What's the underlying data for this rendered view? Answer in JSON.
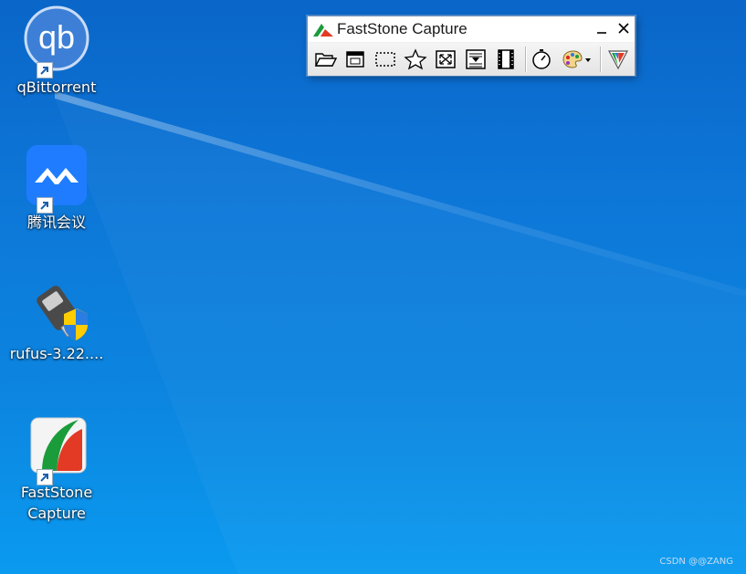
{
  "desktop": {
    "icons": [
      {
        "label": "qBittorrent",
        "icon": "qbittorrent-icon",
        "shortcut": true
      },
      {
        "label": "腾讯会议",
        "icon": "tencent-meeting-icon",
        "shortcut": true
      },
      {
        "label": "rufus-3.22....",
        "icon": "rufus-usb-icon",
        "shortcut": false
      },
      {
        "label": "FastStone\nCapture",
        "icon": "faststone-capture-icon",
        "shortcut": true
      }
    ],
    "watermark": "CSDN @@ZANG"
  },
  "faststone": {
    "title": "FastStone Capture",
    "tools": [
      "open-file-icon",
      "capture-active-window-icon",
      "capture-rectangular-region-icon",
      "capture-freehand-region-icon",
      "capture-full-screen-icon",
      "capture-scrolling-window-icon",
      "screen-recorder-icon",
      "delay-timer-icon",
      "output-palette-icon",
      "settings-menu-icon"
    ]
  },
  "colors": {
    "desktop_top": "#0a66c8",
    "desktop_bottom": "#0a9af0",
    "qb_blue": "#3a7dd8",
    "tencent_blue": "#1f7cff"
  }
}
